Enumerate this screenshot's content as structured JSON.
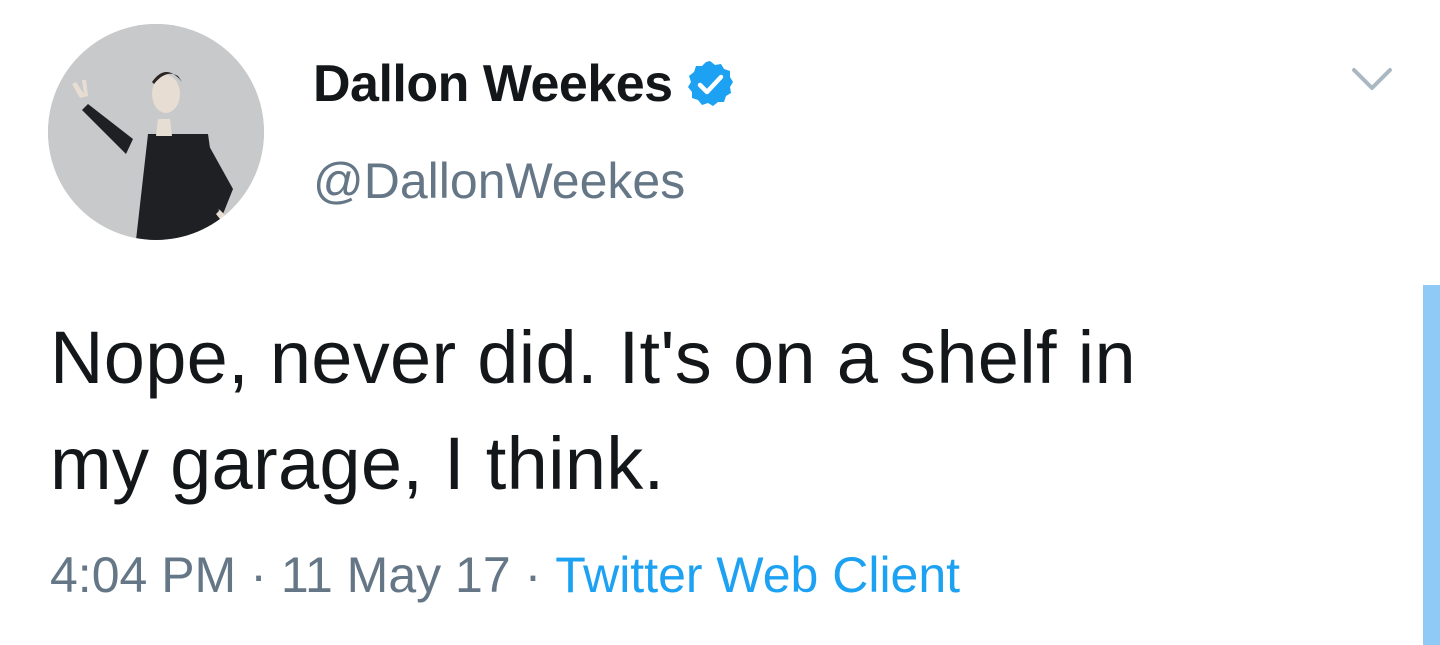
{
  "user": {
    "display_name": "Dallon Weekes",
    "handle": "@DallonWeekes",
    "verified": true,
    "verified_icon": "verified-badge-icon",
    "avatar_icon": "avatar"
  },
  "tweet": {
    "text_line_1": "Nope, never did. It's on a shelf in",
    "text_line_2": "my garage, I think."
  },
  "meta": {
    "time": "4:04 PM",
    "separator": "·",
    "date": "11 May 17",
    "source": "Twitter Web Client"
  },
  "controls": {
    "more_icon": "chevron-down-icon"
  },
  "colors": {
    "text": "#14171a",
    "secondary": "#657786",
    "accent": "#1da1f2",
    "scrollbar": "#8ecaf5"
  }
}
